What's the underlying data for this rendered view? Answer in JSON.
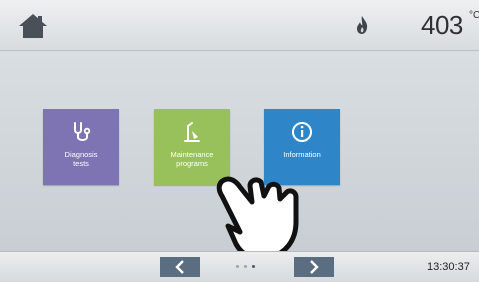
{
  "header": {
    "home_icon": "home-icon",
    "heating_icon": "flame-icon",
    "temperature": "403",
    "temperature_unit": "°C"
  },
  "tiles": [
    {
      "label": "Diagnosis\ntests",
      "icon": "stethoscope-icon",
      "color": "#7e74b4"
    },
    {
      "label": "Maintenance\nprograms",
      "icon": "maintenance-icon",
      "color": "#98c15c"
    },
    {
      "label": "Information",
      "icon": "info-icon",
      "color": "#2e86c9"
    }
  ],
  "footer": {
    "prev_icon": "chevron-left-icon",
    "next_icon": "chevron-right-icon",
    "page_indicator": {
      "pages": 3,
      "active": 3
    },
    "time": "13:30:37"
  }
}
